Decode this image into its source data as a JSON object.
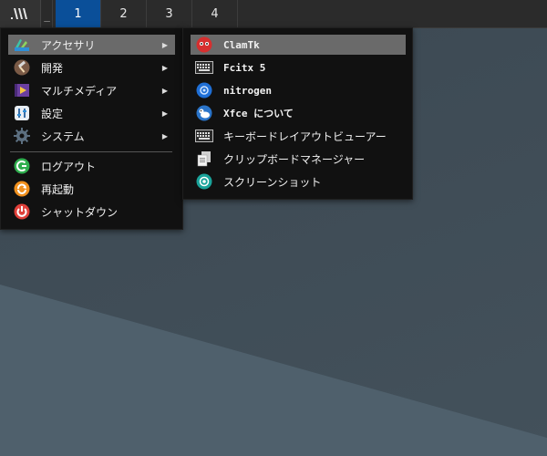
{
  "panel": {
    "launcher_icon": "tilted-bars-logo-icon",
    "handle_label": "_",
    "workspaces": [
      {
        "label": "1",
        "active": true
      },
      {
        "label": "2",
        "active": false
      },
      {
        "label": "3",
        "active": false
      },
      {
        "label": "4",
        "active": false
      }
    ]
  },
  "main_menu": {
    "items": [
      {
        "label": "アクセサリ",
        "icon": "accessories-icon",
        "submenu": true,
        "highlighted": true
      },
      {
        "label": "開発",
        "icon": "development-hammer-icon",
        "submenu": true
      },
      {
        "label": "マルチメディア",
        "icon": "multimedia-icon",
        "submenu": true
      },
      {
        "label": "設定",
        "icon": "settings-icon",
        "submenu": true
      },
      {
        "label": "システム",
        "icon": "system-gear-icon",
        "submenu": true
      },
      {
        "label": "ログアウト",
        "icon": "logout-icon",
        "submenu": false
      },
      {
        "label": "再起動",
        "icon": "restart-icon",
        "submenu": false
      },
      {
        "label": "シャットダウン",
        "icon": "shutdown-icon",
        "submenu": false
      }
    ],
    "arrow_glyph": "▶"
  },
  "sub_menu": {
    "items": [
      {
        "label": "ClamTk",
        "icon": "clamtk-icon",
        "highlighted": true
      },
      {
        "label": "Fcitx 5",
        "icon": "keyboard-icon"
      },
      {
        "label": "nitrogen",
        "icon": "nitrogen-icon"
      },
      {
        "label": "Xfce について",
        "icon": "xfce-mouse-icon"
      },
      {
        "label": "キーボードレイアウトビューアー",
        "icon": "keyboard-icon"
      },
      {
        "label": "クリップボードマネージャー",
        "icon": "clipboard-icon"
      },
      {
        "label": "スクリーンショット",
        "icon": "screenshot-icon"
      }
    ]
  },
  "colors": {
    "active_workspace": "#0a4f99",
    "menu_bg": "#111111",
    "highlight": "#6a6a6a"
  }
}
